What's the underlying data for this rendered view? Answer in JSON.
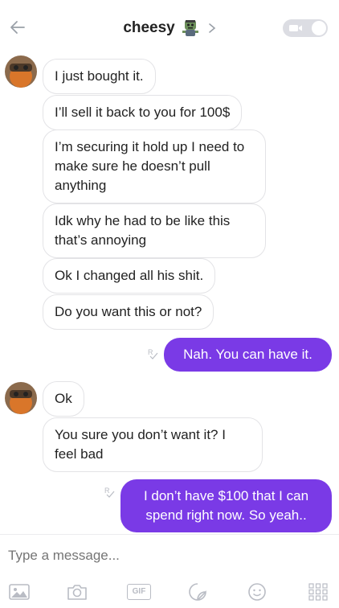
{
  "header": {
    "title": "cheesy"
  },
  "messages": [
    {
      "side": "in",
      "text": "I just bought it."
    },
    {
      "side": "in",
      "text": "I’ll sell it back to you for 100$"
    },
    {
      "side": "in",
      "text": "I’m securing it hold up I need to make sure he doesn’t pull anything"
    },
    {
      "side": "in",
      "text": "Idk why he had to be like this that’s annoying"
    },
    {
      "side": "in",
      "text": "Ok I changed all his shit."
    },
    {
      "side": "in",
      "text": "Do you want this or not?"
    },
    {
      "side": "out",
      "text": "Nah. You can have it."
    },
    {
      "side": "in",
      "text": "Ok"
    },
    {
      "side": "in",
      "text": "You sure you don’t want it? I feel bad"
    },
    {
      "side": "out",
      "text": "I don’t have $100 that I can spend right now. So yeah.."
    }
  ],
  "composer": {
    "placeholder": "Type a message...",
    "gif_label": "GIF"
  },
  "colors": {
    "accent": "#7a3ae6",
    "incoming_border": "#e3e3e6",
    "icon_gray": "#b9bcc4"
  }
}
